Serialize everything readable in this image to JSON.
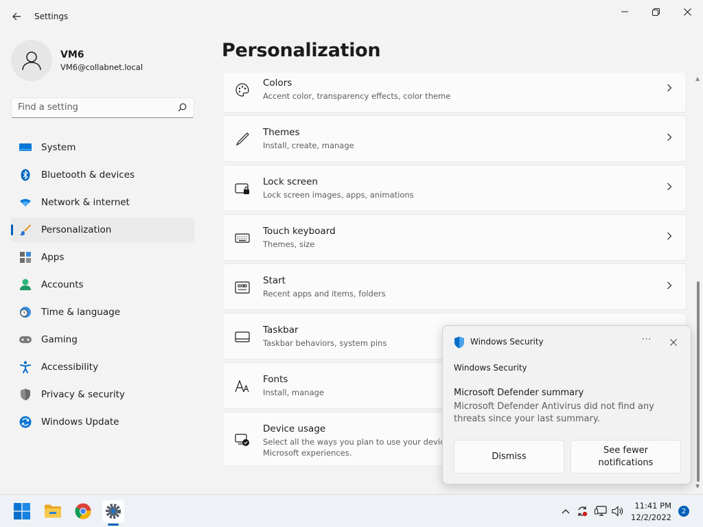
{
  "window": {
    "title": "Settings"
  },
  "profile": {
    "name": "VM6",
    "email": "VM6@collabnet.local"
  },
  "search": {
    "placeholder": "Find a setting"
  },
  "nav": {
    "items": [
      {
        "label": "System",
        "icon": "system-icon"
      },
      {
        "label": "Bluetooth & devices",
        "icon": "bluetooth-icon"
      },
      {
        "label": "Network & internet",
        "icon": "wifi-icon"
      },
      {
        "label": "Personalization",
        "icon": "brush-icon",
        "active": true
      },
      {
        "label": "Apps",
        "icon": "apps-icon"
      },
      {
        "label": "Accounts",
        "icon": "accounts-icon"
      },
      {
        "label": "Time & language",
        "icon": "clock-globe-icon"
      },
      {
        "label": "Gaming",
        "icon": "gamepad-icon"
      },
      {
        "label": "Accessibility",
        "icon": "accessibility-icon"
      },
      {
        "label": "Privacy & security",
        "icon": "shield-icon"
      },
      {
        "label": "Windows Update",
        "icon": "update-icon"
      }
    ]
  },
  "page": {
    "title": "Personalization"
  },
  "cards": [
    {
      "title": "Colors",
      "subtitle": "Accent color, transparency effects, color theme",
      "icon": "palette-icon"
    },
    {
      "title": "Themes",
      "subtitle": "Install, create, manage",
      "icon": "pen-icon"
    },
    {
      "title": "Lock screen",
      "subtitle": "Lock screen images, apps, animations",
      "icon": "lock-screen-icon"
    },
    {
      "title": "Touch keyboard",
      "subtitle": "Themes, size",
      "icon": "keyboard-icon"
    },
    {
      "title": "Start",
      "subtitle": "Recent apps and items, folders",
      "icon": "start-icon"
    },
    {
      "title": "Taskbar",
      "subtitle": "Taskbar behaviors, system pins",
      "icon": "taskbar-icon"
    },
    {
      "title": "Fonts",
      "subtitle": "Install, manage",
      "icon": "fonts-icon"
    },
    {
      "title": "Device usage",
      "subtitle": "Select all the ways you plan to use your device to",
      "subtitle2": "Microsoft experiences.",
      "icon": "device-usage-icon"
    }
  ],
  "toast": {
    "app": "Windows Security",
    "source": "Windows Security",
    "heading": "Microsoft Defender summary",
    "body": "Microsoft Defender Antivirus did not find any threats since your last summary.",
    "dismiss_label": "Dismiss",
    "fewer_label": "See fewer notifications",
    "more_label": "···"
  },
  "taskbar": {
    "time": "11:41 PM",
    "date": "12/2/2022",
    "notification_count": "2"
  },
  "colors": {
    "accent": "#005fb8",
    "system_icon": "#0078d4",
    "bluetooth": "#0067c0"
  }
}
